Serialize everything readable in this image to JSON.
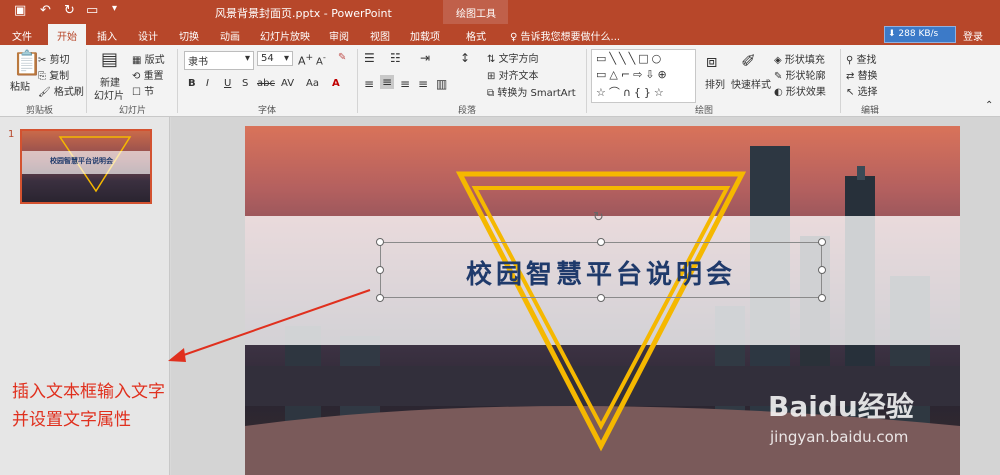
{
  "app": {
    "document_title": "风景背景封面页.pptx - PowerPoint",
    "contextual_tools": "绘图工具",
    "tell_me": "告诉我您想要做什么...",
    "net_speed": "288 KB/s",
    "login": "登录"
  },
  "tabs": [
    {
      "label": "文件"
    },
    {
      "label": "开始"
    },
    {
      "label": "插入"
    },
    {
      "label": "设计"
    },
    {
      "label": "切换"
    },
    {
      "label": "动画"
    },
    {
      "label": "幻灯片放映"
    },
    {
      "label": "审阅"
    },
    {
      "label": "视图"
    },
    {
      "label": "加载项"
    },
    {
      "label": "格式"
    }
  ],
  "ribbon": {
    "clipboard": {
      "paste": "粘贴",
      "cut": "剪切",
      "copy": "复制",
      "format_painter": "格式刷",
      "group": "剪贴板"
    },
    "slides": {
      "new_slide_1": "新建",
      "new_slide_2": "幻灯片",
      "layout": "版式",
      "reset": "重置",
      "section": "节",
      "group": "幻灯片"
    },
    "font": {
      "name": "隶书",
      "size": "54",
      "bold": "B",
      "italic": "I",
      "underline": "U",
      "shadow": "S",
      "strike": "abc",
      "spacing": "AV",
      "case": "Aa",
      "color": "A",
      "group": "字体"
    },
    "paragraph": {
      "text_direction": "文字方向",
      "align_text": "对齐文本",
      "smartart": "转换为 SmartArt",
      "group": "段落"
    },
    "drawing": {
      "arrange": "排列",
      "quick_styles": "快速样式",
      "fill": "形状填充",
      "outline": "形状轮廓",
      "effects": "形状效果",
      "group": "绘图"
    },
    "editing": {
      "find": "查找",
      "replace": "替换",
      "select": "选择",
      "group": "编辑"
    }
  },
  "slides_panel": {
    "number": "1",
    "thumb_title": "校园智慧平台说明会"
  },
  "slide": {
    "title": "校园智慧平台说明会"
  },
  "annotation": {
    "line1": "插入文本框输入文字",
    "line2": "并设置文字属性"
  },
  "watermark": {
    "brand": "Baidu经验",
    "url": "jingyan.baidu.com"
  },
  "colors": {
    "accent": "#b7472a",
    "title_text": "#1f3a6b",
    "triangle": "#f5b800",
    "annotation": "#e0301e"
  }
}
